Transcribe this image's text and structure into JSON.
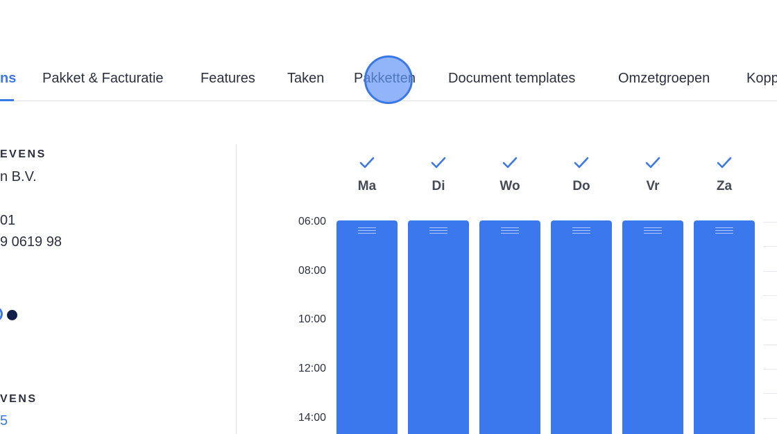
{
  "tabs": [
    {
      "label": "ns",
      "active": true
    },
    {
      "label": "Pakket & Facturatie",
      "active": false
    },
    {
      "label": "Features",
      "active": false
    },
    {
      "label": "Taken",
      "active": false
    },
    {
      "label": "Pakketten",
      "active": false
    },
    {
      "label": "Document templates",
      "active": false
    },
    {
      "label": "Omzetgroepen",
      "active": false
    },
    {
      "label": "Kopp",
      "active": false
    }
  ],
  "info": {
    "section1_heading": "EVENS",
    "company_name": "n B.V.",
    "line_number": "01",
    "phone": "9 0619 98",
    "section2_heading": "VENS",
    "section2_value": "5"
  },
  "schedule": {
    "days": [
      {
        "label": "Ma",
        "checked": true
      },
      {
        "label": "Di",
        "checked": true
      },
      {
        "label": "Wo",
        "checked": true
      },
      {
        "label": "Do",
        "checked": true
      },
      {
        "label": "Vr",
        "checked": true
      },
      {
        "label": "Za",
        "checked": true
      }
    ],
    "times": [
      "06:00",
      "08:00",
      "10:00",
      "12:00",
      "14:00"
    ]
  },
  "colors": {
    "accent": "#3b78e7",
    "block": "#3b78ee",
    "text": "#2b3040",
    "dot_dark": "#0f1f4a"
  }
}
